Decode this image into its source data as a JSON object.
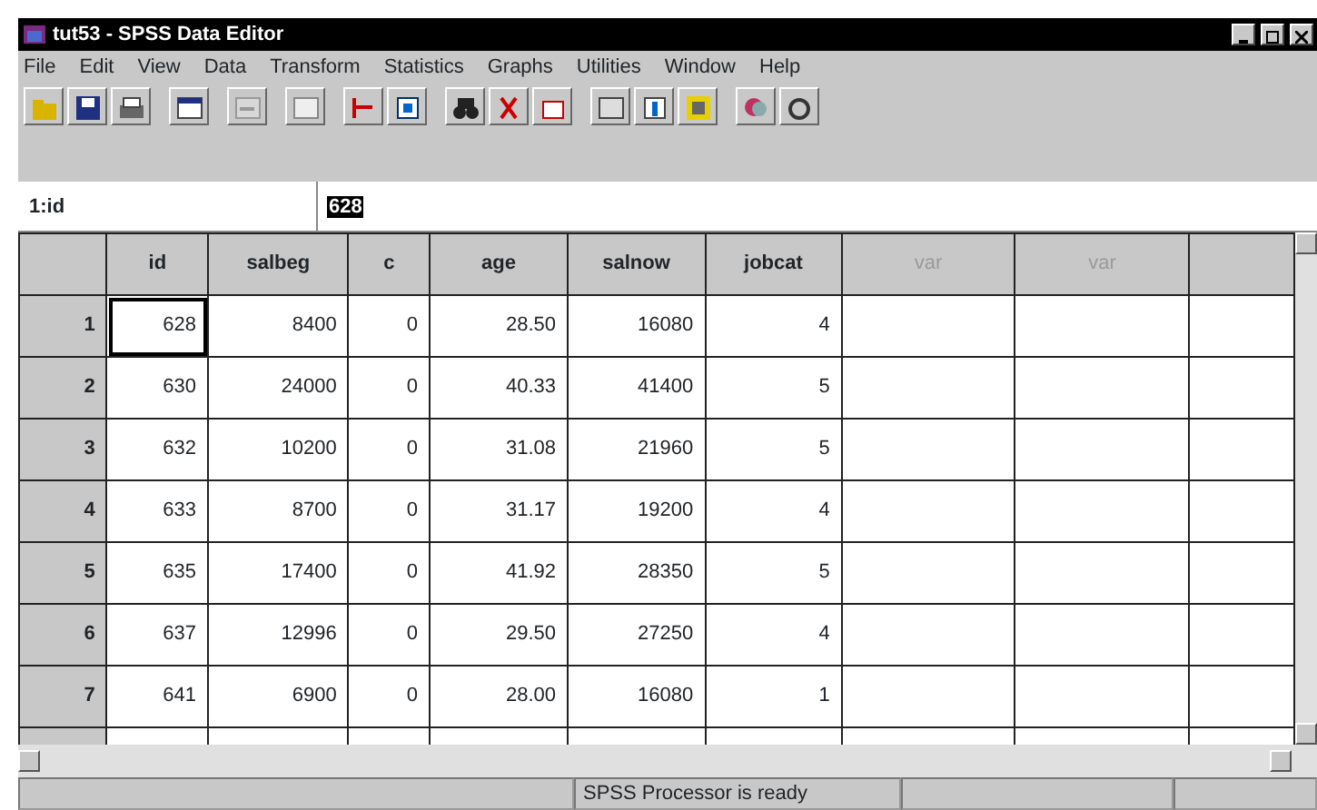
{
  "window": {
    "title": "tut53 - SPSS Data Editor"
  },
  "menu": [
    "File",
    "Edit",
    "View",
    "Data",
    "Transform",
    "Statistics",
    "Graphs",
    "Utilities",
    "Window",
    "Help"
  ],
  "cell_editor": {
    "cell": "1:id",
    "value": "628"
  },
  "table": {
    "columns": [
      {
        "label": "id",
        "kind": "variable"
      },
      {
        "label": "salbeg",
        "kind": "variable"
      },
      {
        "label": "c",
        "kind": "variable"
      },
      {
        "label": "age",
        "kind": "variable"
      },
      {
        "label": "salnow",
        "kind": "variable"
      },
      {
        "label": "jobcat",
        "kind": "variable"
      },
      {
        "label": "var",
        "kind": "empty"
      },
      {
        "label": "var",
        "kind": "empty"
      }
    ],
    "rows": [
      {
        "number": "1",
        "cells": [
          "628",
          "8400",
          "0",
          "28.50",
          "16080",
          "4"
        ]
      },
      {
        "number": "2",
        "cells": [
          "630",
          "24000",
          "0",
          "40.33",
          "41400",
          "5"
        ]
      },
      {
        "number": "3",
        "cells": [
          "632",
          "10200",
          "0",
          "31.08",
          "21960",
          "5"
        ]
      },
      {
        "number": "4",
        "cells": [
          "633",
          "8700",
          "0",
          "31.17",
          "19200",
          "4"
        ]
      },
      {
        "number": "5",
        "cells": [
          "635",
          "17400",
          "0",
          "41.92",
          "28350",
          "5"
        ]
      },
      {
        "number": "6",
        "cells": [
          "637",
          "12996",
          "0",
          "29.50",
          "27250",
          "4"
        ]
      },
      {
        "number": "7",
        "cells": [
          "641",
          "6900",
          "0",
          "28.00",
          "16080",
          "1"
        ]
      }
    ]
  },
  "status_bar": {
    "text": "SPSS Processor is ready"
  }
}
